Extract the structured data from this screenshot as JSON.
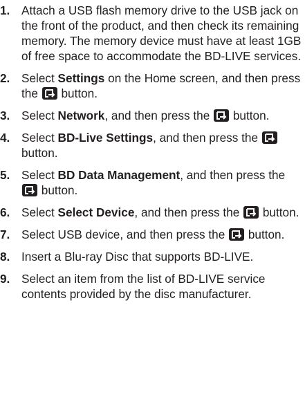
{
  "steps": [
    {
      "number": "1.",
      "text": "Attach a USB flash memory drive to the USB jack on the front of the product, and then check its remaining memory. The memory device must have at least 1GB of free space to accommodate the BD-LIVE services."
    },
    {
      "number": "2.",
      "pre": "Select ",
      "bold": "Settings",
      "post": " on the Home screen, and then press the ",
      "tail": " button."
    },
    {
      "number": "3.",
      "pre": "Select ",
      "bold": "Network",
      "post": ", and then press the ",
      "tail": " button."
    },
    {
      "number": "4.",
      "pre": "Select ",
      "bold": "BD-Live Settings",
      "post": ", and then press the ",
      "tail": " button."
    },
    {
      "number": "5.",
      "pre": "Select ",
      "bold": "BD Data Management",
      "post": ", and then press the ",
      "tail": " button."
    },
    {
      "number": "6.",
      "pre": "Select ",
      "bold": "Select Device",
      "post": ", and then press the ",
      "tail": " button."
    },
    {
      "number": "7.",
      "pre": "Select USB device, and then press the ",
      "tail": " button."
    },
    {
      "number": "8.",
      "text": "Insert a Blu-ray Disc that supports BD-LIVE."
    },
    {
      "number": "9.",
      "text": "Select an item from the list of BD-LIVE service contents provided by the disc manufacturer."
    }
  ],
  "icons": {
    "enter_button": "enter-button-icon"
  },
  "colors": {
    "text": "#231f20",
    "icon_background": "#231f20",
    "icon_foreground": "#ffffff"
  }
}
